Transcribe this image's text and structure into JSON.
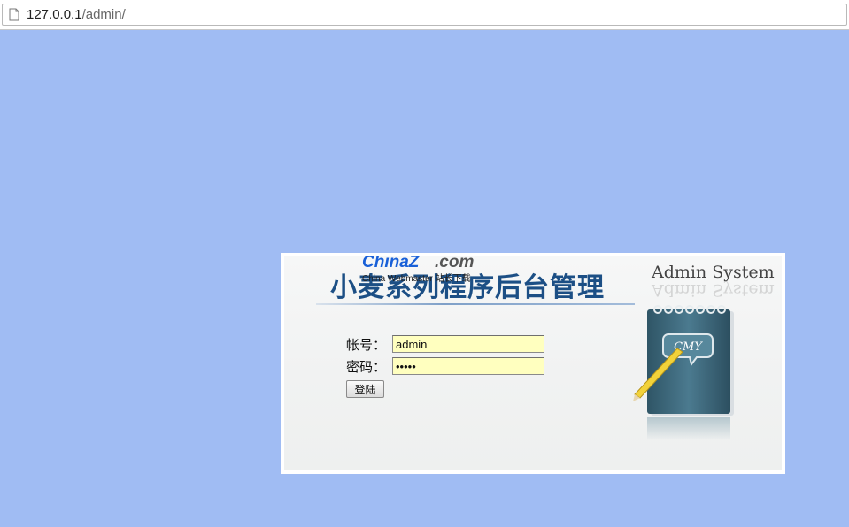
{
  "browser": {
    "url_host": "127.0.0.1",
    "url_path": "/admin/"
  },
  "watermark": {
    "brand": "ChinaZ",
    "domain": ".com",
    "subtitle": "China Webmaster 站长下载"
  },
  "login_panel": {
    "title": "小麦系列程序后台管理",
    "admin_system": "Admin System",
    "notebook_logo_text": "CMY",
    "account_label": "帐号：",
    "account_value": "admin",
    "password_label": "密码：",
    "password_value": "admin",
    "login_button": "登陆"
  },
  "colors": {
    "page_background": "#a0bcf3",
    "title_color": "#1c4f85",
    "input_background": "#ffffbf",
    "notebook_color": "#3f6a7d"
  }
}
